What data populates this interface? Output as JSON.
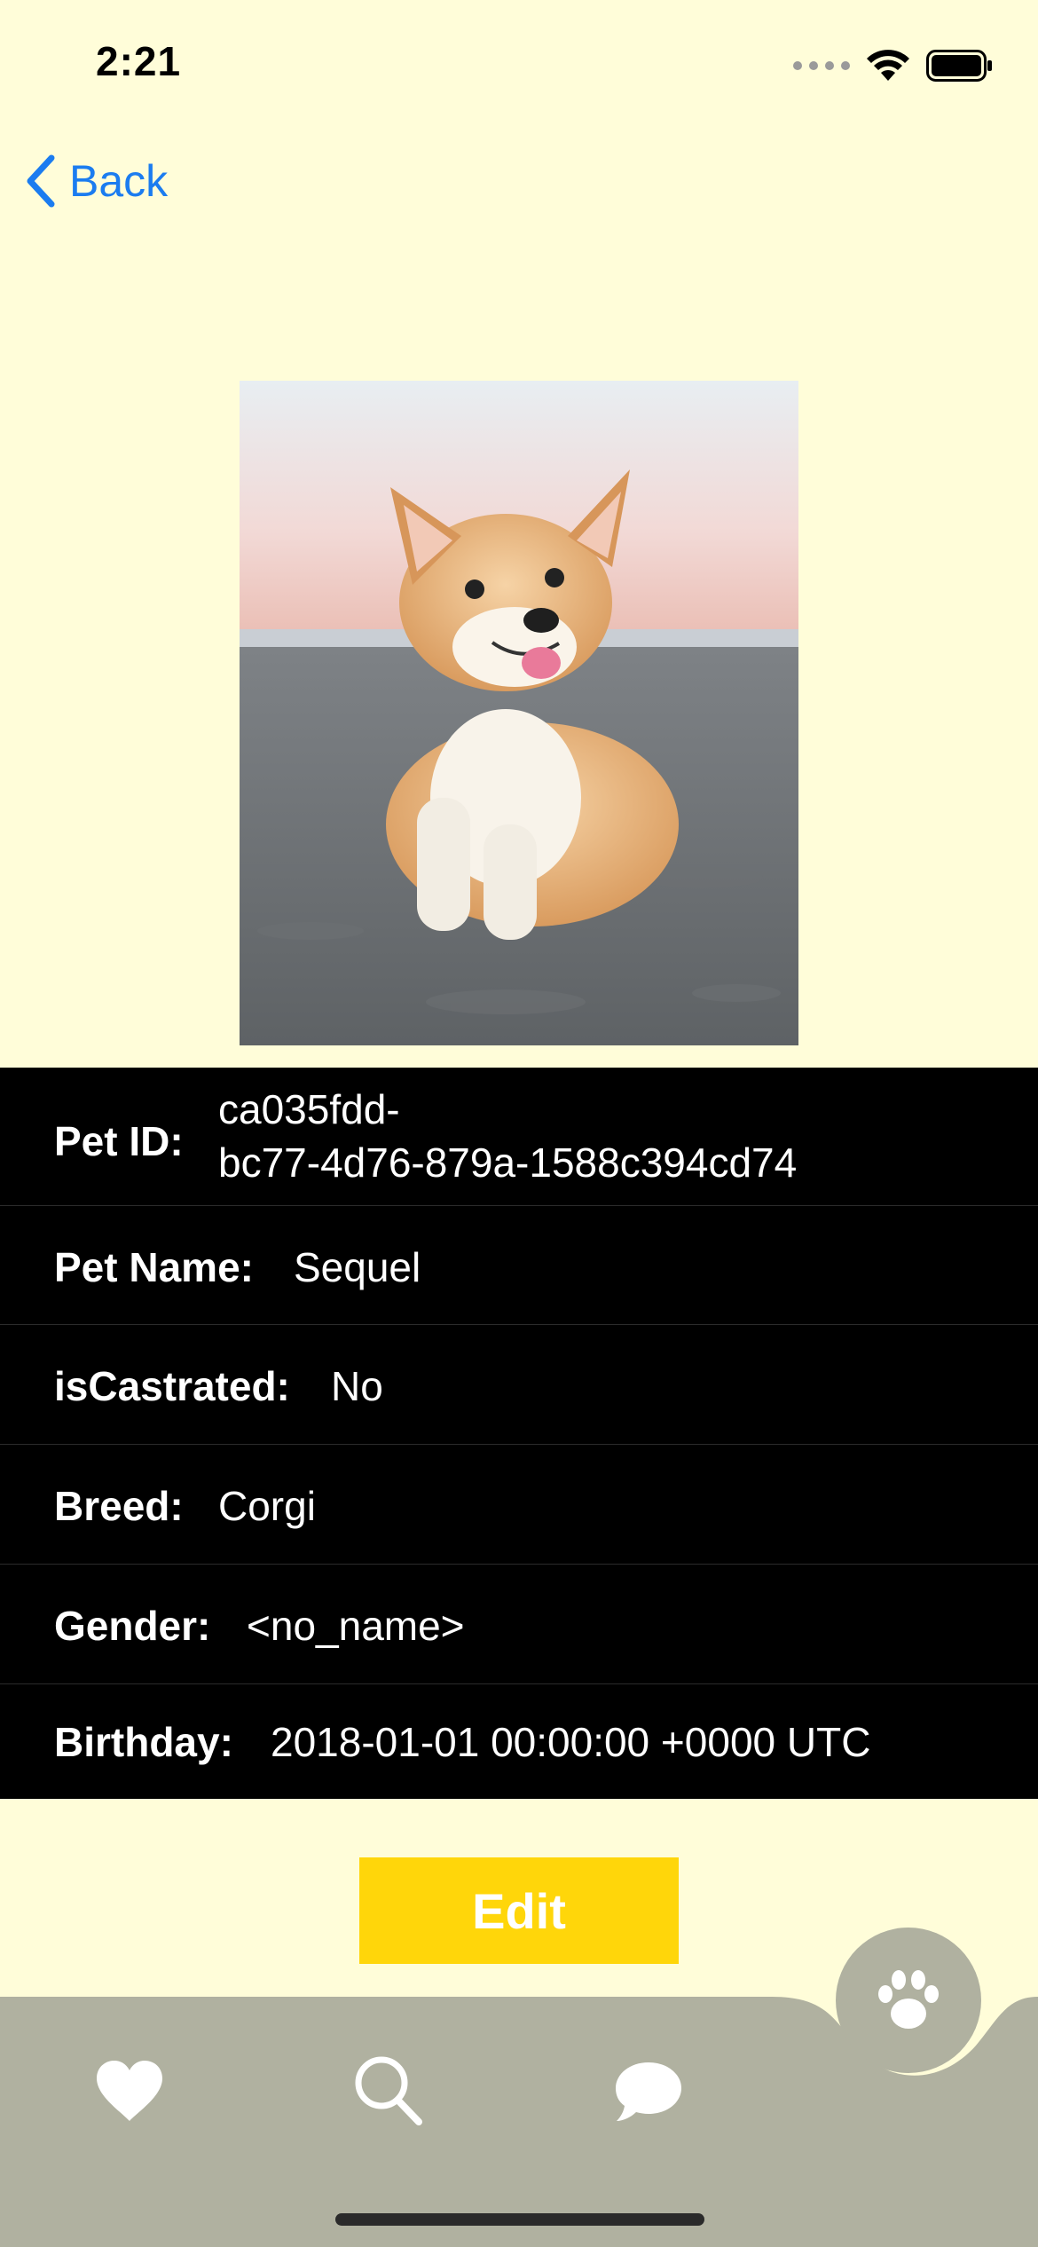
{
  "status_bar": {
    "time": "2:21"
  },
  "nav": {
    "back_label": "Back"
  },
  "pet": {
    "photo_alt": "corgi-photo",
    "fields": [
      {
        "label": "Pet ID:",
        "value_line1": "ca035fdd-",
        "value_line2": "bc77-4d76-879a-1588c394cd74"
      },
      {
        "label": "Pet Name:",
        "value": "Sequel"
      },
      {
        "label": "isCastrated:",
        "value": "No"
      },
      {
        "label": "Breed:",
        "value": "Corgi"
      },
      {
        "label": "Gender:",
        "value": "<no_name>"
      },
      {
        "label": "Birthday:",
        "value": "2018-01-01 00:00:00 +0000 UTC"
      }
    ]
  },
  "actions": {
    "edit_label": "Edit"
  },
  "tab_bar": {
    "items": [
      {
        "name": "favorites",
        "icon": "heart-icon"
      },
      {
        "name": "search",
        "icon": "search-icon"
      },
      {
        "name": "messages",
        "icon": "chat-bubble-icon"
      },
      {
        "name": "pets",
        "icon": "paw-icon",
        "selected": true
      }
    ]
  },
  "colors": {
    "background": "#FFFDD9",
    "accent_blue": "#1B7CF0",
    "edit_button": "#FFD60A",
    "tab_bar": "#B0B1A0",
    "info_panel": "#000000"
  }
}
